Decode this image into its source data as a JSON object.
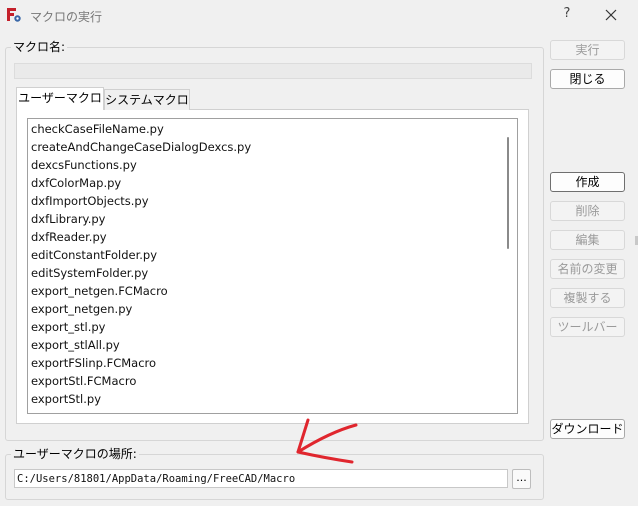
{
  "window": {
    "title": "マクロの実行",
    "help_label": "?",
    "app_icon": "freecad-icon",
    "close_icon": "close-icon"
  },
  "macro_name_group": {
    "title": "マクロ名:",
    "input_value": ""
  },
  "tabs": [
    {
      "label": "ユーザーマクロ",
      "active": true
    },
    {
      "label": "システムマクロ",
      "active": false
    }
  ],
  "macro_list": [
    "checkCaseFileName.py",
    "createAndChangeCaseDialogDexcs.py",
    "dexcsFunctions.py",
    "dxfColorMap.py",
    "dxfImportObjects.py",
    "dxfLibrary.py",
    "dxfReader.py",
    "editConstantFolder.py",
    "editSystemFolder.py",
    "export_netgen.FCMacro",
    "export_netgen.py",
    "export_stl.py",
    "export_stlAll.py",
    "exportFSlinp.FCMacro",
    "exportStl.FCMacro",
    "exportStl.py"
  ],
  "location_group": {
    "title": "ユーザーマクロの場所:",
    "path": "C:/Users/81801/AppData/Roaming/FreeCAD/Macro",
    "browse_label": "..."
  },
  "buttons": {
    "execute": "実行",
    "close": "閉じる",
    "create": "作成",
    "delete": "削除",
    "edit": "編集",
    "rename": "名前の変更",
    "duplicate": "複製する",
    "toolbar": "ツールバー",
    "download": "ダウンロード"
  },
  "colors": {
    "background": "#f0f0f0",
    "annotation_arrow": "#e0262e",
    "disabled_text": "#9a9a9a"
  }
}
